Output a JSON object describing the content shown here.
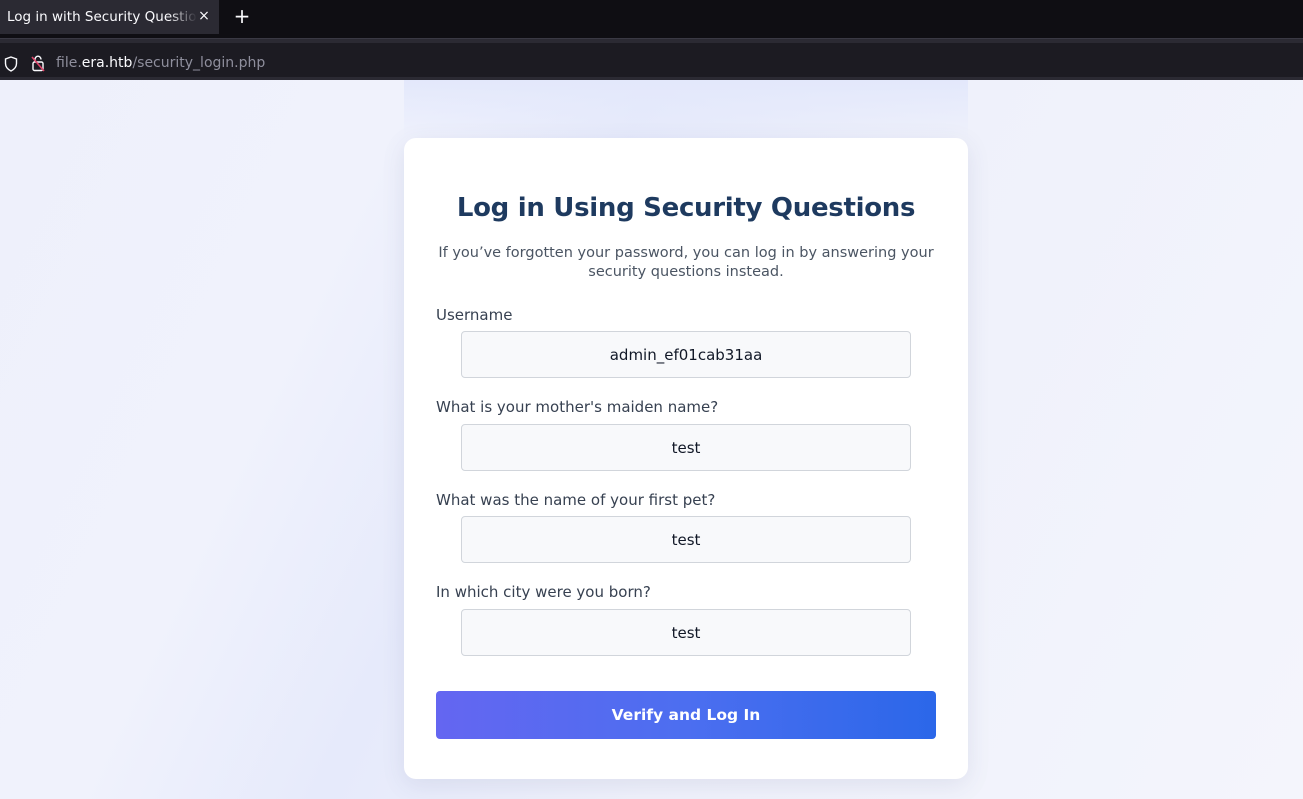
{
  "browser": {
    "tab_title": "Log in with Security Questions",
    "tab_close": "×",
    "new_tab": "+",
    "url_prefix": "file.",
    "url_host": "era.htb",
    "url_path": "/security_login.php"
  },
  "form": {
    "title": "Log in Using Security Questions",
    "subtitle": "If you’ve forgotten your password, you can log in by answering your security questions instead.",
    "fields": [
      {
        "label": "Username",
        "value": "admin_ef01cab31aa"
      },
      {
        "label": "What is your mother's maiden name?",
        "value": "test"
      },
      {
        "label": "What was the name of your first pet?",
        "value": "test"
      },
      {
        "label": "In which city were you born?",
        "value": "test"
      }
    ],
    "submit_label": "Verify and Log In"
  },
  "colors": {
    "title": "#1e3a5f",
    "button_start": "#6466f1",
    "button_end": "#2b67e9",
    "lock_icon": "#e0456b"
  }
}
